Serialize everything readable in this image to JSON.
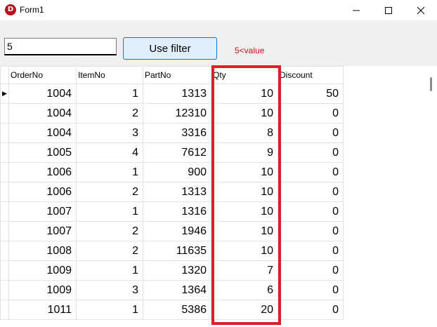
{
  "window": {
    "title": "Form1",
    "icon_glyph": "D",
    "icon_name": "app-icon",
    "accent": "#b3121a"
  },
  "toolbar": {
    "filter_value": "5",
    "filter_button_label": "Use filter",
    "filter_expression": "5<value",
    "expression_color": "#c0141a"
  },
  "grid": {
    "columns": [
      "OrderNo",
      "ItemNo",
      "PartNo",
      "Qty",
      "Discount"
    ],
    "rows": [
      [
        "1004",
        "1",
        "1313",
        "10",
        "50"
      ],
      [
        "1004",
        "2",
        "12310",
        "10",
        "0"
      ],
      [
        "1004",
        "3",
        "3316",
        "8",
        "0"
      ],
      [
        "1005",
        "4",
        "7612",
        "9",
        "0"
      ],
      [
        "1006",
        "1",
        "900",
        "10",
        "0"
      ],
      [
        "1006",
        "2",
        "1313",
        "10",
        "0"
      ],
      [
        "1007",
        "1",
        "1316",
        "10",
        "0"
      ],
      [
        "1007",
        "2",
        "1946",
        "10",
        "0"
      ],
      [
        "1008",
        "2",
        "11635",
        "10",
        "0"
      ],
      [
        "1009",
        "1",
        "1320",
        "7",
        "0"
      ],
      [
        "1009",
        "3",
        "1364",
        "6",
        "0"
      ],
      [
        "1011",
        "1",
        "5386",
        "20",
        "0"
      ]
    ],
    "current_row_marker": "▶",
    "highlight_column": "Qty",
    "highlight_color": "#d6222b"
  }
}
